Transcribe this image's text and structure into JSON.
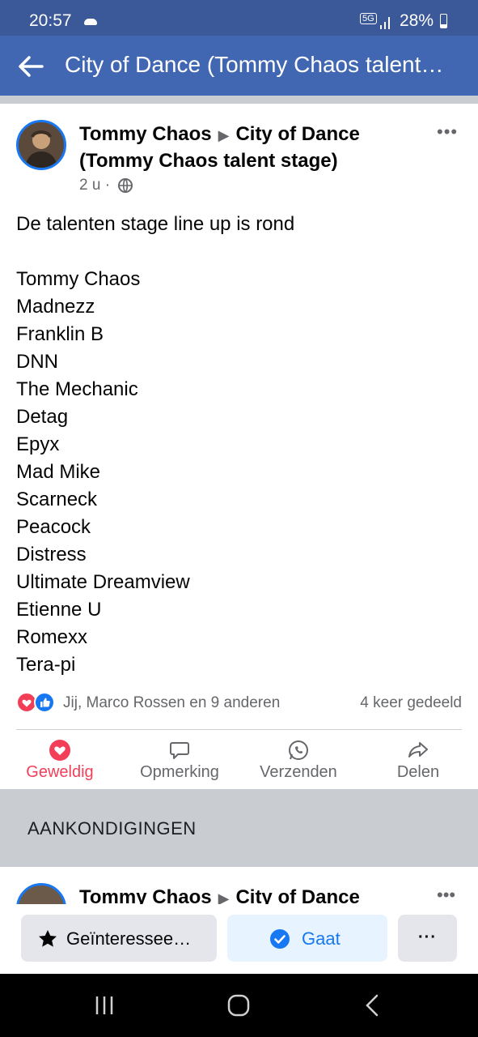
{
  "status": {
    "time": "20:57",
    "network": "5G",
    "battery": "28%"
  },
  "appbar": {
    "title": "City of Dance (Tommy Chaos talent…"
  },
  "post": {
    "author": "Tommy Chaos",
    "target": "City of Dance (Tommy Chaos talent stage)",
    "time": "2 u ·",
    "headline": "De talenten stage line up is rond",
    "lineup": [
      "Tommy Chaos",
      "Madnezz",
      "Franklin B",
      "DNN",
      "The Mechanic",
      "Detag",
      "Epyx",
      "Mad Mike",
      "Scarneck",
      "Peacock",
      "Distress",
      "Ultimate Dreamview",
      "Etienne U",
      "Romexx",
      "Tera-pi"
    ],
    "reactions": "Jij, Marco Rossen en 9 anderen",
    "shares": "4 keer gedeeld",
    "actions": {
      "love": "Geweldig",
      "comment": "Opmerking",
      "send": "Verzenden",
      "share": "Delen"
    }
  },
  "section": {
    "label": "AANKONDIGINGEN"
  },
  "post2": {
    "author": "Tommy Chaos",
    "target": "City of Dance"
  },
  "bottom": {
    "interested": "Geïnteressee…",
    "going": "Gaat",
    "more": "···"
  },
  "colors": {
    "appbar": "#4267b2",
    "statusbar": "#3b5998",
    "accent": "#1877f2",
    "love": "#f33e58"
  }
}
